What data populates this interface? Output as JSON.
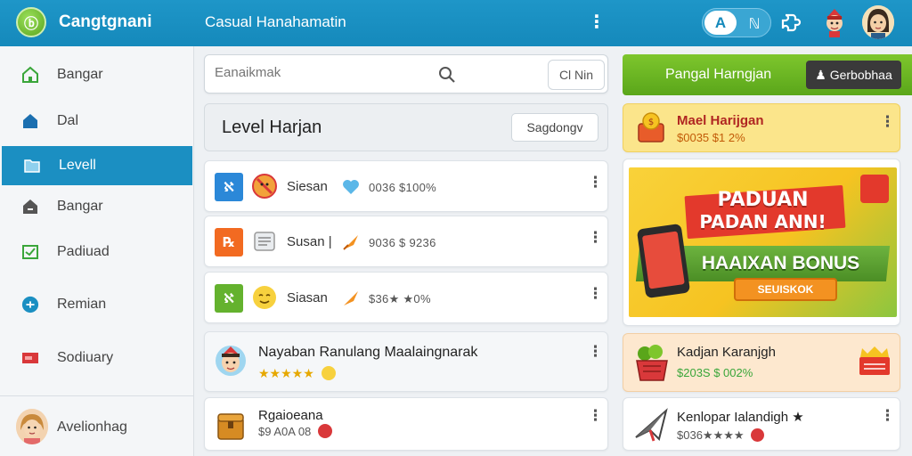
{
  "header": {
    "logo_glyph": "ⓑ",
    "app_title": "Cangtgnani",
    "window_title": "Casual Hanahamatin",
    "toggle_primary": "A",
    "toggle_secondary": "ℕ",
    "icons": [
      "menu-dots-icon",
      "puzzle-icon",
      "character-avatar-icon",
      "user-avatar-icon"
    ]
  },
  "sidebar": {
    "items": [
      {
        "label": "Bangar",
        "icon": "home-icon",
        "color": "#3aa63a"
      },
      {
        "label": "Dal",
        "icon": "house-icon",
        "color": "#1b6fb0"
      },
      {
        "label": "Levell",
        "icon": "folder-icon",
        "color": "#ffffff",
        "active": true
      },
      {
        "label": "Bangar",
        "icon": "tag-icon",
        "color": "#555555"
      },
      {
        "label": "Padiuad",
        "icon": "check-icon",
        "color": "#3aa63a"
      },
      {
        "label": "Remian",
        "icon": "circle-plus-icon",
        "color": "#1b8fc2"
      },
      {
        "label": "Sodiuary",
        "icon": "card-icon",
        "color": "#d9383a"
      }
    ],
    "user_label": "Avelionhag"
  },
  "search": {
    "placeholder": "Eanaikmak",
    "button_label": "Cl Nin"
  },
  "section": {
    "title": "Level Harjan",
    "button_label": "Sagdongv"
  },
  "rows": [
    {
      "icon_text": "ℵ",
      "icon_color": "#2b88d8",
      "name": "Siesan",
      "value": "0036 $100%"
    },
    {
      "icon_text": "℞",
      "icon_color": "#f26a21",
      "name": "Susan |",
      "value": "9036 $ 9236"
    },
    {
      "icon_text": "ℵ",
      "icon_color": "#64b22e",
      "name": "Siasan",
      "value": "$36★ ★0%"
    }
  ],
  "featured_rows": [
    {
      "title": "Nayaban Ranulang Maalaingnarak",
      "rating": "★★★★★"
    },
    {
      "title": "Rgaioeana",
      "rating": "$9 A0A 08"
    }
  ],
  "promo": {
    "title": "Pangal Harngjan",
    "button_label": "♟ Gerbobhaa"
  },
  "cards": [
    {
      "title": "Mael Harijgan",
      "value": "$0035 $1 2%"
    },
    {
      "title": "Kadjan Karanjgh",
      "value": "$203S $ 002%"
    },
    {
      "title": "Kenlopar Ialandigh ★",
      "value": "$036★★★★"
    }
  ],
  "banner": {
    "headline_1": "PADUAN",
    "headline_2": "PADAN ANN!",
    "bonus": "HAAIXAN BONUS",
    "cta": "SEUISKOK"
  },
  "colors": {
    "topbar": "#1589bb",
    "active_nav": "#1b8fc2",
    "promo_green": "#6cb528"
  }
}
